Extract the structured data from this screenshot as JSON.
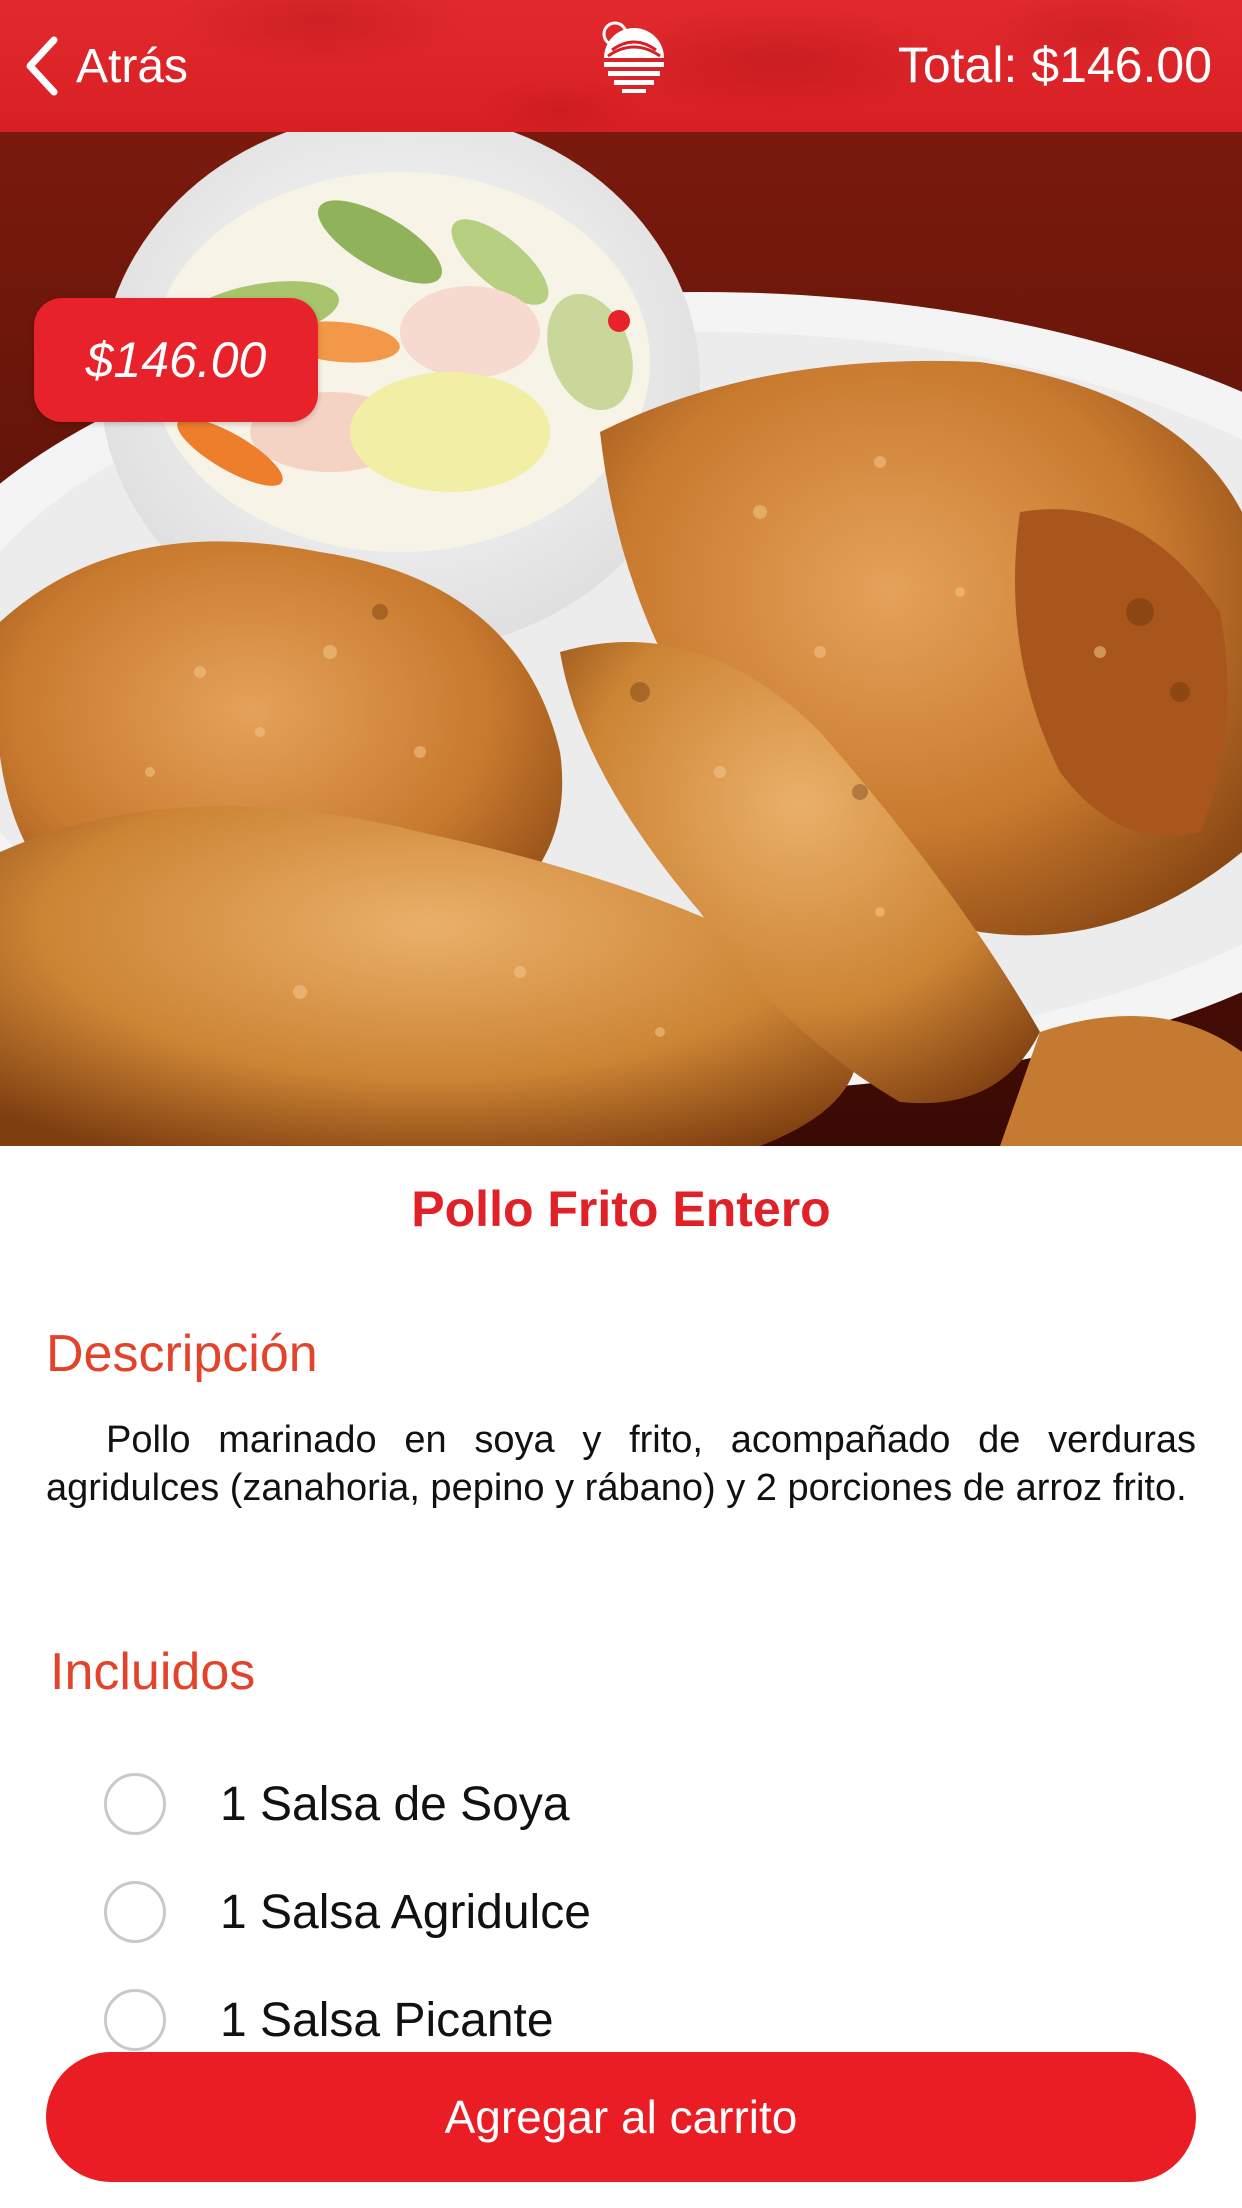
{
  "header": {
    "back_label": "Atrás",
    "total_text": "Total: $146.00"
  },
  "hero": {
    "price_badge": "$146.00"
  },
  "product": {
    "title": "Pollo Frito Entero"
  },
  "description": {
    "heading": "Descripción",
    "text": "Pollo marinado en soya y frito, acompañado de verduras agridulces (zanahoria, pepino y rábano) y 2 porciones de arroz frito."
  },
  "included": {
    "heading": "Incluidos",
    "items": [
      {
        "label": "1 Salsa de Soya",
        "checked": false
      },
      {
        "label": "1 Salsa Agridulce",
        "checked": false
      },
      {
        "label": "1 Salsa Picante",
        "checked": false
      }
    ]
  },
  "actions": {
    "add_to_cart_label": "Agregar al carrito"
  },
  "colors": {
    "brand_red": "#e8222a",
    "heading_orange_red": "#e2432a",
    "header_red": "#d81f24"
  }
}
